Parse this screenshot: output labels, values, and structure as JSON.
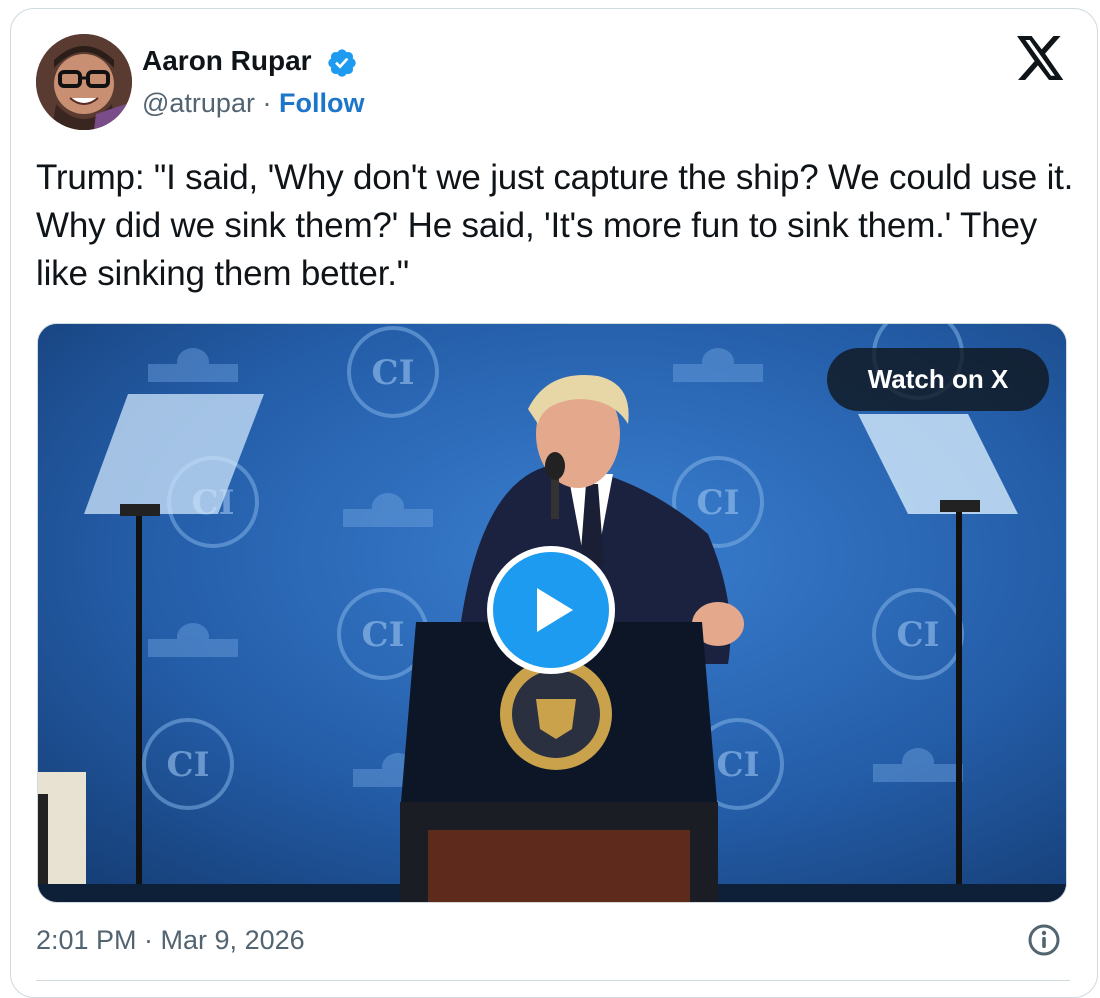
{
  "author": {
    "display_name": "Aaron Rupar",
    "handle": "@atrupar",
    "separator": "·",
    "follow_label": "Follow",
    "verified": true
  },
  "tweet": {
    "text": "Trump: \"I said, 'Why don't we just capture the ship? We could use it. Why did we sink them?' He said, 'It's more fun to sink them.' They like sinking them better.\""
  },
  "media": {
    "watch_label": "Watch on X",
    "backdrop_logo_text": "CI"
  },
  "footer": {
    "timestamp": "2:01 PM · Mar 9, 2026"
  },
  "icons": {
    "brand": "x-logo-icon",
    "verified": "verified-badge-icon",
    "play": "play-icon",
    "info": "info-icon"
  },
  "colors": {
    "accent": "#1d9bf0",
    "follow_link": "#1d76c9",
    "text_primary": "#0f1419",
    "text_secondary": "#536471",
    "border": "#cfd9de",
    "backdrop_blue": "#1e4f8c"
  }
}
